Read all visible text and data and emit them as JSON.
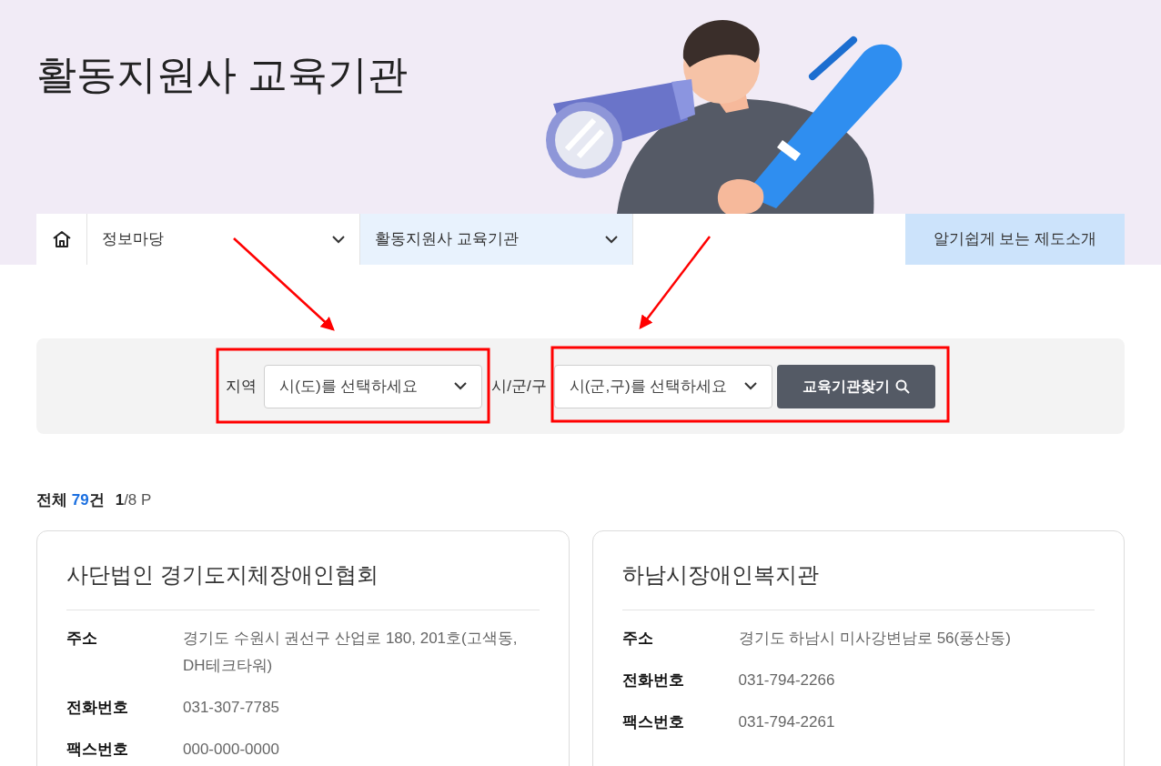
{
  "page_title": "활동지원사 교육기관",
  "nav": {
    "menus": [
      {
        "label": "정보마당",
        "selected": false
      },
      {
        "label": "활동지원사 교육기관",
        "selected": true
      }
    ],
    "guide_button": "알기쉽게 보는 제도소개"
  },
  "filter": {
    "fields": [
      {
        "label": "지역",
        "placeholder": "시(도)를 선택하세요"
      },
      {
        "label": "시/군/구",
        "placeholder": "시(군,구)를 선택하세요"
      }
    ],
    "search_button": "교육기관찾기"
  },
  "summary": {
    "total_label": "전체",
    "total_count": "79",
    "total_unit": "건",
    "page_current": "1",
    "page_rest": "/8 P"
  },
  "cards": [
    {
      "name": "사단법인 경기도지체장애인협회",
      "rows": [
        {
          "label": "주소",
          "value": "경기도 수원시 권선구 산업로 180, 201호(고색동, DH테크타워)"
        },
        {
          "label": "전화번호",
          "value": "031-307-7785"
        },
        {
          "label": "팩스번호",
          "value": "000-000-0000"
        }
      ]
    },
    {
      "name": "하남시장애인복지관",
      "rows": [
        {
          "label": "주소",
          "value": "경기도 하남시 미사강변남로 56(풍산동)"
        },
        {
          "label": "전화번호",
          "value": "031-794-2266"
        },
        {
          "label": "팩스번호",
          "value": "031-794-2261"
        }
      ]
    }
  ]
}
